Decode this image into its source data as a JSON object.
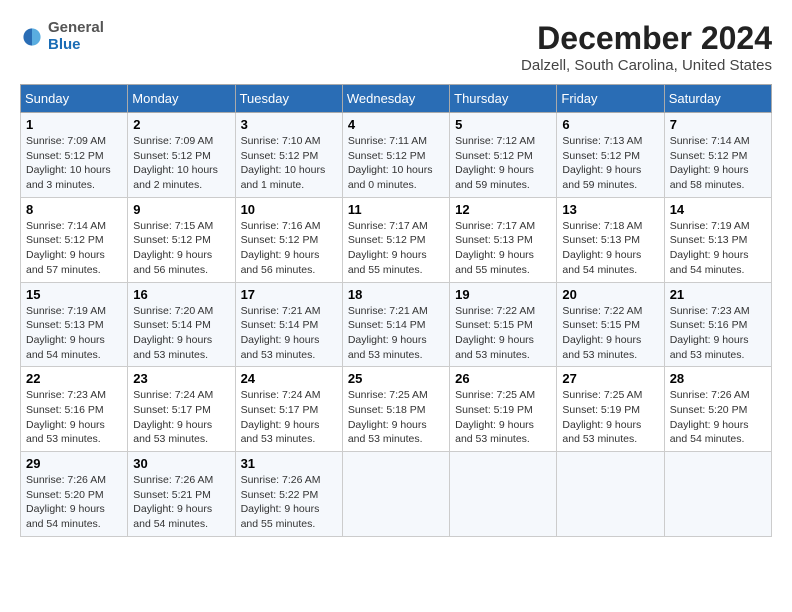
{
  "header": {
    "logo_general": "General",
    "logo_blue": "Blue",
    "month_title": "December 2024",
    "location": "Dalzell, South Carolina, United States"
  },
  "weekdays": [
    "Sunday",
    "Monday",
    "Tuesday",
    "Wednesday",
    "Thursday",
    "Friday",
    "Saturday"
  ],
  "weeks": [
    [
      {
        "day": "1",
        "sunrise": "7:09 AM",
        "sunset": "5:12 PM",
        "daylight": "10 hours and 3 minutes."
      },
      {
        "day": "2",
        "sunrise": "7:09 AM",
        "sunset": "5:12 PM",
        "daylight": "10 hours and 2 minutes."
      },
      {
        "day": "3",
        "sunrise": "7:10 AM",
        "sunset": "5:12 PM",
        "daylight": "10 hours and 1 minute."
      },
      {
        "day": "4",
        "sunrise": "7:11 AM",
        "sunset": "5:12 PM",
        "daylight": "10 hours and 0 minutes."
      },
      {
        "day": "5",
        "sunrise": "7:12 AM",
        "sunset": "5:12 PM",
        "daylight": "9 hours and 59 minutes."
      },
      {
        "day": "6",
        "sunrise": "7:13 AM",
        "sunset": "5:12 PM",
        "daylight": "9 hours and 59 minutes."
      },
      {
        "day": "7",
        "sunrise": "7:14 AM",
        "sunset": "5:12 PM",
        "daylight": "9 hours and 58 minutes."
      }
    ],
    [
      {
        "day": "8",
        "sunrise": "7:14 AM",
        "sunset": "5:12 PM",
        "daylight": "9 hours and 57 minutes."
      },
      {
        "day": "9",
        "sunrise": "7:15 AM",
        "sunset": "5:12 PM",
        "daylight": "9 hours and 56 minutes."
      },
      {
        "day": "10",
        "sunrise": "7:16 AM",
        "sunset": "5:12 PM",
        "daylight": "9 hours and 56 minutes."
      },
      {
        "day": "11",
        "sunrise": "7:17 AM",
        "sunset": "5:12 PM",
        "daylight": "9 hours and 55 minutes."
      },
      {
        "day": "12",
        "sunrise": "7:17 AM",
        "sunset": "5:13 PM",
        "daylight": "9 hours and 55 minutes."
      },
      {
        "day": "13",
        "sunrise": "7:18 AM",
        "sunset": "5:13 PM",
        "daylight": "9 hours and 54 minutes."
      },
      {
        "day": "14",
        "sunrise": "7:19 AM",
        "sunset": "5:13 PM",
        "daylight": "9 hours and 54 minutes."
      }
    ],
    [
      {
        "day": "15",
        "sunrise": "7:19 AM",
        "sunset": "5:13 PM",
        "daylight": "9 hours and 54 minutes."
      },
      {
        "day": "16",
        "sunrise": "7:20 AM",
        "sunset": "5:14 PM",
        "daylight": "9 hours and 53 minutes."
      },
      {
        "day": "17",
        "sunrise": "7:21 AM",
        "sunset": "5:14 PM",
        "daylight": "9 hours and 53 minutes."
      },
      {
        "day": "18",
        "sunrise": "7:21 AM",
        "sunset": "5:14 PM",
        "daylight": "9 hours and 53 minutes."
      },
      {
        "day": "19",
        "sunrise": "7:22 AM",
        "sunset": "5:15 PM",
        "daylight": "9 hours and 53 minutes."
      },
      {
        "day": "20",
        "sunrise": "7:22 AM",
        "sunset": "5:15 PM",
        "daylight": "9 hours and 53 minutes."
      },
      {
        "day": "21",
        "sunrise": "7:23 AM",
        "sunset": "5:16 PM",
        "daylight": "9 hours and 53 minutes."
      }
    ],
    [
      {
        "day": "22",
        "sunrise": "7:23 AM",
        "sunset": "5:16 PM",
        "daylight": "9 hours and 53 minutes."
      },
      {
        "day": "23",
        "sunrise": "7:24 AM",
        "sunset": "5:17 PM",
        "daylight": "9 hours and 53 minutes."
      },
      {
        "day": "24",
        "sunrise": "7:24 AM",
        "sunset": "5:17 PM",
        "daylight": "9 hours and 53 minutes."
      },
      {
        "day": "25",
        "sunrise": "7:25 AM",
        "sunset": "5:18 PM",
        "daylight": "9 hours and 53 minutes."
      },
      {
        "day": "26",
        "sunrise": "7:25 AM",
        "sunset": "5:19 PM",
        "daylight": "9 hours and 53 minutes."
      },
      {
        "day": "27",
        "sunrise": "7:25 AM",
        "sunset": "5:19 PM",
        "daylight": "9 hours and 53 minutes."
      },
      {
        "day": "28",
        "sunrise": "7:26 AM",
        "sunset": "5:20 PM",
        "daylight": "9 hours and 54 minutes."
      }
    ],
    [
      {
        "day": "29",
        "sunrise": "7:26 AM",
        "sunset": "5:20 PM",
        "daylight": "9 hours and 54 minutes."
      },
      {
        "day": "30",
        "sunrise": "7:26 AM",
        "sunset": "5:21 PM",
        "daylight": "9 hours and 54 minutes."
      },
      {
        "day": "31",
        "sunrise": "7:26 AM",
        "sunset": "5:22 PM",
        "daylight": "9 hours and 55 minutes."
      },
      null,
      null,
      null,
      null
    ]
  ],
  "labels": {
    "sunrise": "Sunrise:",
    "sunset": "Sunset:",
    "daylight": "Daylight:"
  }
}
